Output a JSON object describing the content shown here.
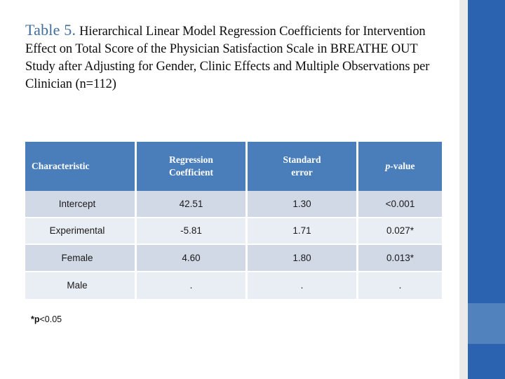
{
  "slide": {
    "background_color": "#ffffff",
    "side_bar_color": "#2b63b0",
    "side_bar_accent_color": "#5182be",
    "side_strip_color": "#eaeaea"
  },
  "title": {
    "label": "Table 5.",
    "label_color": "#3f6e9e",
    "text": "Hierarchical Linear Model Regression Coefficients for Intervention Effect on Total Score of the Physician Satisfaction Scale in BREATHE OUT Study after Adjusting for Gender, Clinic Effects and Multiple Observations per Clinician (n=112)"
  },
  "table": {
    "header_bg": "#4a7ebb",
    "header_text_color": "#ffffff",
    "row_dark_bg": "#d2d9e6",
    "row_light_bg": "#e9edf4",
    "significant_color": "#b02222",
    "columns": [
      {
        "line1": "Characteristic",
        "line2": ""
      },
      {
        "line1": "Regression",
        "line2": "Coefficient"
      },
      {
        "line1": "Standard",
        "line2": "error"
      },
      {
        "line1": "p",
        "line2": "-value"
      }
    ],
    "rows": [
      {
        "characteristic": "Intercept",
        "regression_coefficient": "42.51",
        "standard_error": "1.30",
        "p_value": "<0.001",
        "significant": false
      },
      {
        "characteristic": "Experimental",
        "regression_coefficient": "-5.81",
        "standard_error": "1.71",
        "p_value": "0.027*",
        "significant": true
      },
      {
        "characteristic": "Female",
        "regression_coefficient": "4.60",
        "standard_error": "1.80",
        "p_value": "0.013*",
        "significant": true
      },
      {
        "characteristic": "Male",
        "regression_coefficient": ".",
        "standard_error": ".",
        "p_value": ".",
        "significant": false
      }
    ]
  },
  "footnote": {
    "marker": "*p",
    "rest": "<0.05"
  }
}
